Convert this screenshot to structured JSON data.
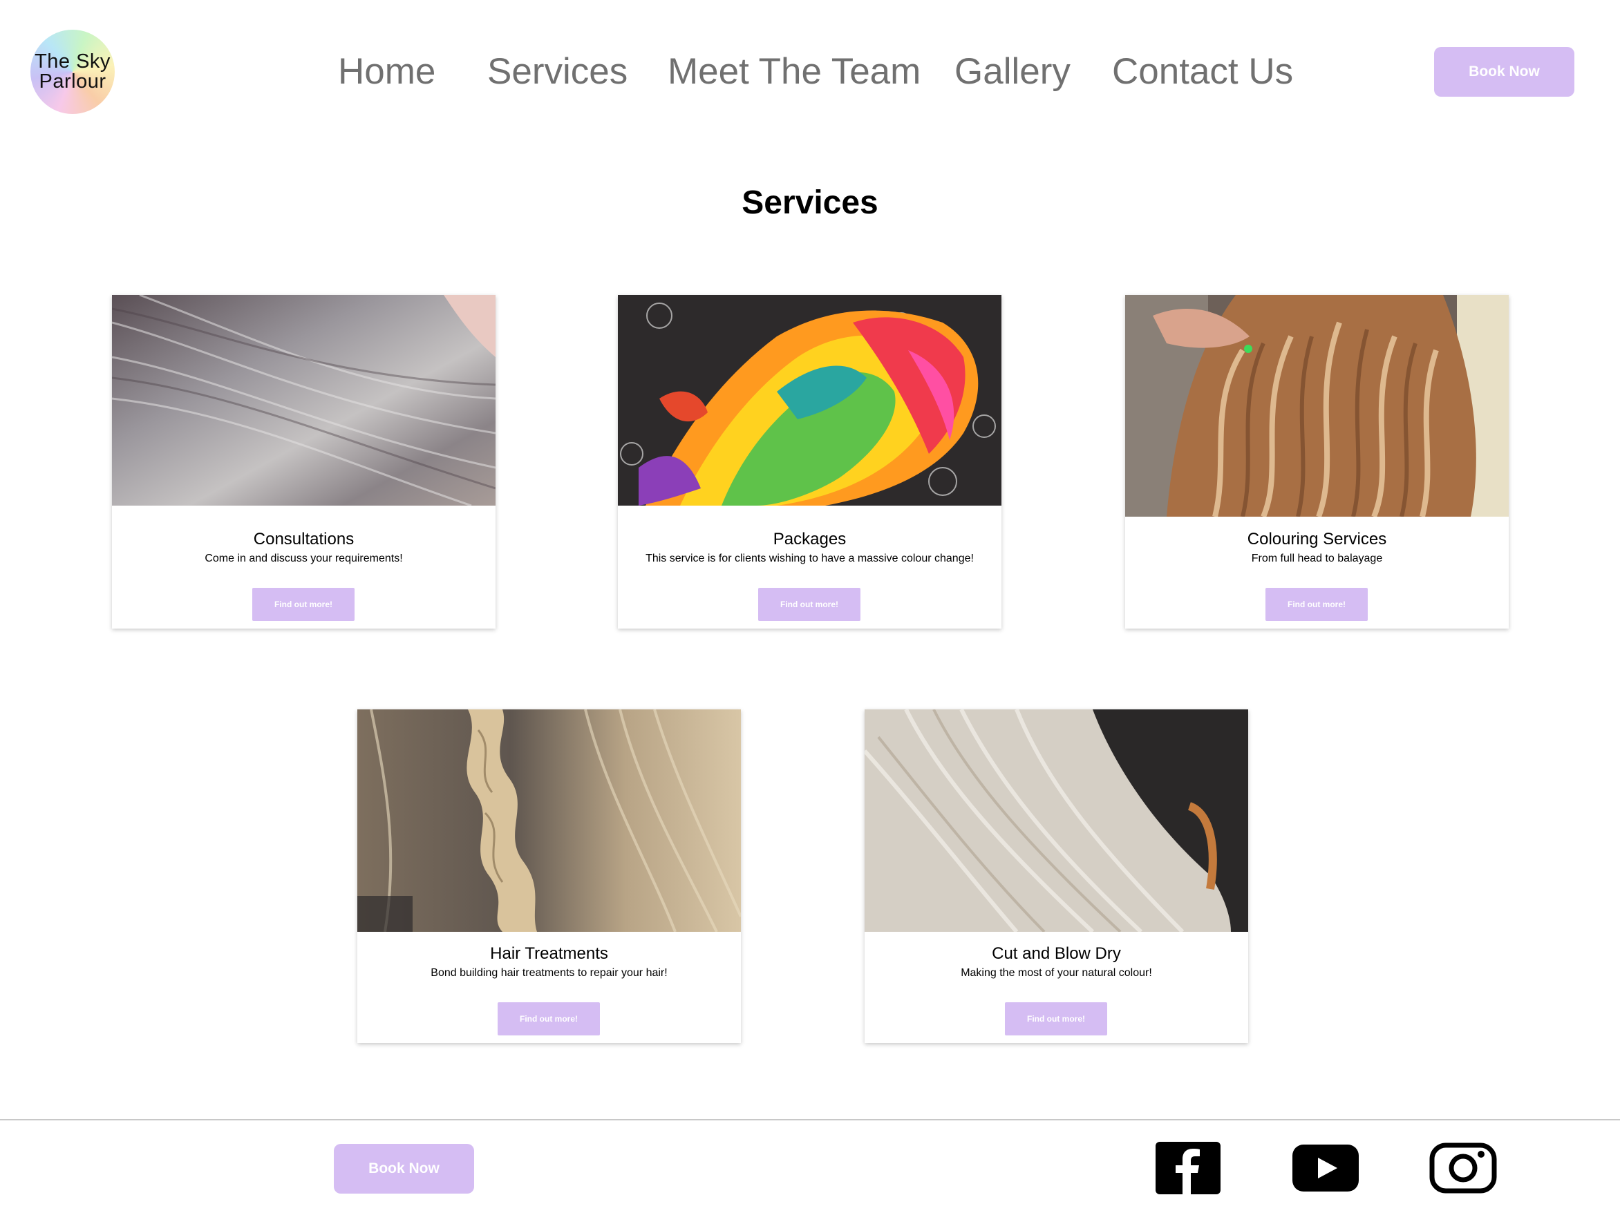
{
  "header": {
    "logo_line1": "The Sky",
    "logo_line2": "Parlour",
    "nav": [
      "Home",
      "Services",
      "Meet The Team",
      "Gallery",
      "Contact Us"
    ],
    "book_label": "Book Now"
  },
  "main": {
    "title": "Services",
    "cards": [
      {
        "title": "Consultations",
        "desc": "Come in and discuss your requirements!",
        "button": "Find out more!"
      },
      {
        "title": "Packages",
        "desc": "This service is for clients wishing to have a massive colour change!",
        "button": "Find out more!"
      },
      {
        "title": "Colouring Services",
        "desc": "From full head to balayage",
        "button": "Find out more!"
      },
      {
        "title": "Hair Treatments",
        "desc": "Bond building hair treatments to repair your hair!",
        "button": "Find out more!"
      },
      {
        "title": "Cut and Blow Dry",
        "desc": "Making the most of your natural colour!",
        "button": "Find out more!"
      }
    ]
  },
  "footer": {
    "book_label": "Book Now",
    "social_icons": [
      "facebook-icon",
      "youtube-icon",
      "instagram-icon"
    ]
  },
  "colors": {
    "accent": "#d5bdf3",
    "nav_text": "#707070",
    "icon": "#000000"
  }
}
